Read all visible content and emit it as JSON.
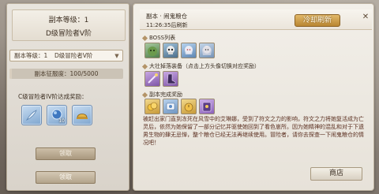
{
  "left": {
    "level_label": "副本等级：1",
    "rank_label": "D级冒险者V阶",
    "select_level": "副本等级：1",
    "select_rank": "D级冒险者V阶",
    "progress_label": "副本征服度：100/5000",
    "progress_fraction": 0.02,
    "rewards_title": "C级冒险者IV阶达成奖励：",
    "rewards": [
      {
        "icon": "feather-icon",
        "count": ""
      },
      {
        "icon": "blue-orb-icon",
        "count": "10"
      },
      {
        "icon": "gold-helmet-icon",
        "count": ""
      }
    ],
    "button_primary": "领取",
    "button_secondary": "领取"
  },
  "right": {
    "title": "副本 · 闹鬼粮仓",
    "refresh_time": "11:26:35后刷新",
    "challenge_label": "冷却刷新",
    "boss_section": "BOSS列表",
    "drop_section": "大壮掉落装备（点击上方头像切换对应奖励）",
    "clear_section": "副本完成奖励",
    "story": "被赶出家门直到冻死在风雪中的艾琳娜，受到了符文之力的影响，符文之力将她复活成为亡灵后，依然为她保留了一部分记忆并驱使她回到了看色崽所。因为她精神的混乱和对于下遗男生物的肆无忌惮，整个粮仓已经无法再继续使用。冒险者，请你去探查一下闹鬼粮仓的情况吧！",
    "shop_label": "商店"
  },
  "colors": {
    "accent_gold": "#c79a4e",
    "story_text": "#5b2f20"
  }
}
